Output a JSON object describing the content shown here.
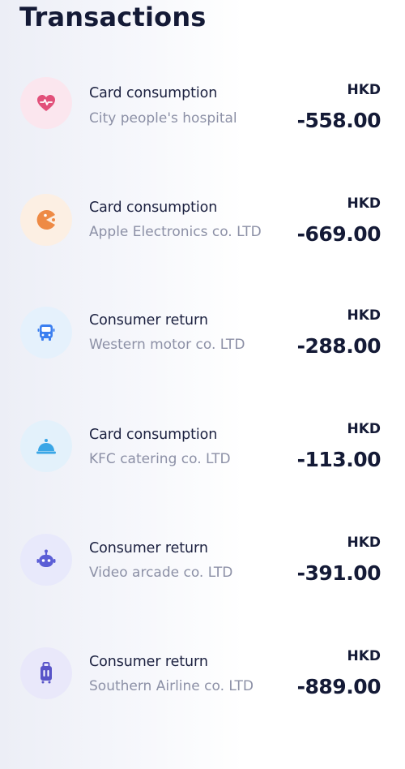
{
  "header": {
    "title": "Transactions"
  },
  "transactions": [
    {
      "title": "Card consumption",
      "merchant": "City people's hospital",
      "currency": "HKD",
      "amount": "-558.00",
      "icon": "heart-icon",
      "icon_color": "#e2507a",
      "icon_bg": "#fbe6ee"
    },
    {
      "title": "Card consumption",
      "merchant": "Apple Electronics co. LTD",
      "currency": "HKD",
      "amount": "-669.00",
      "icon": "pacman-icon",
      "icon_color": "#ee8a45",
      "icon_bg": "#fcefe3"
    },
    {
      "title": "Consumer return",
      "merchant": "Western motor  co. LTD",
      "currency": "HKD",
      "amount": "-288.00",
      "icon": "bus-icon",
      "icon_color": "#3b7ff0",
      "icon_bg": "#e5f1fc"
    },
    {
      "title": "Card consumption",
      "merchant": "KFC catering co. LTD",
      "currency": "HKD",
      "amount": "-113.00",
      "icon": "cloche-icon",
      "icon_color": "#3aa6e6",
      "icon_bg": "#e3f1fb"
    },
    {
      "title": "Consumer return",
      "merchant": "Video arcade co. LTD",
      "currency": "HKD",
      "amount": "-391.00",
      "icon": "robot-icon",
      "icon_color": "#5b5ed6",
      "icon_bg": "#e8e9fb"
    },
    {
      "title": "Consumer return",
      "merchant": "Southern Airline co. LTD",
      "currency": "HKD",
      "amount": "-889.00",
      "icon": "luggage-icon",
      "icon_color": "#5854c8",
      "icon_bg": "#e9e8fa"
    }
  ]
}
